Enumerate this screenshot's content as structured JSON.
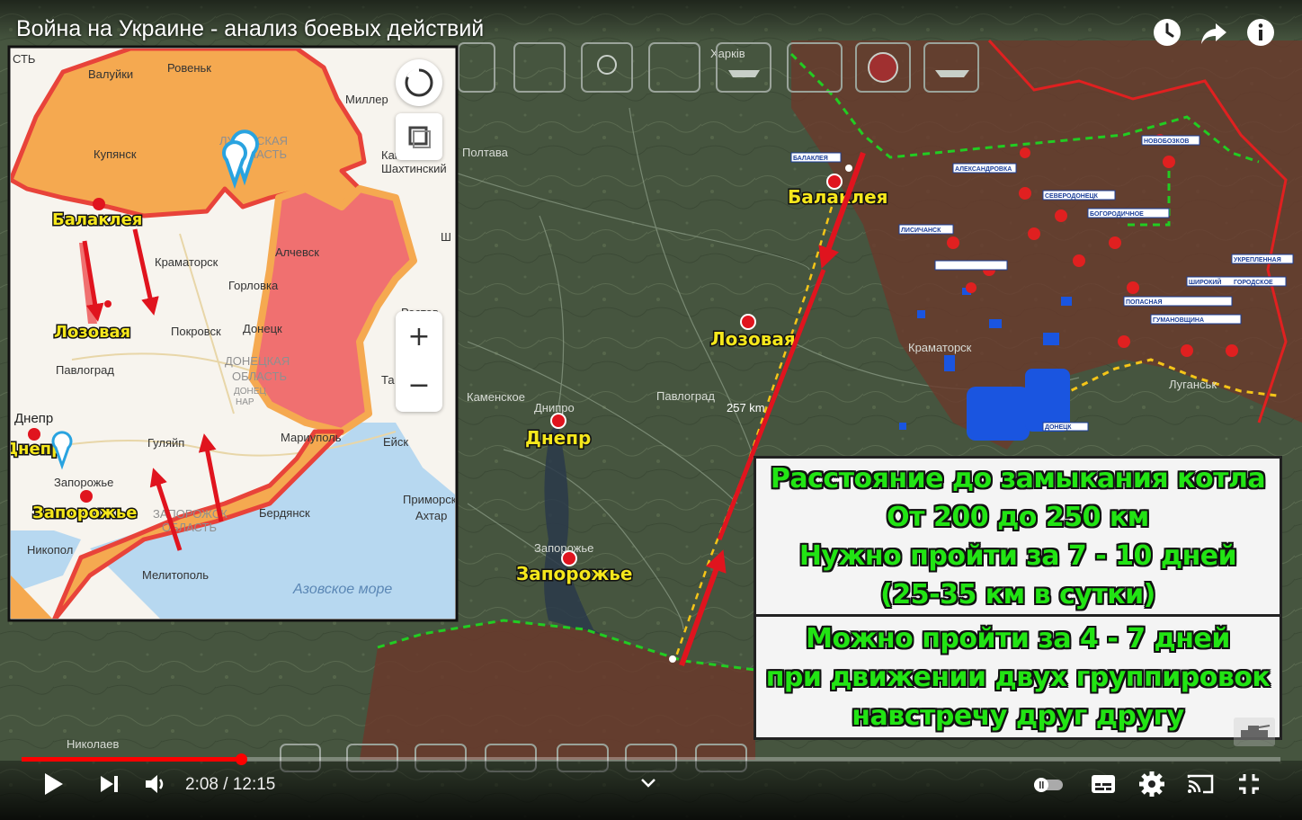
{
  "video": {
    "title": "Война на Украине - анализ боевых действий",
    "time_current": "2:08",
    "time_separator": " / ",
    "time_total": "12:15",
    "progress_fraction": 0.1742,
    "accent": "#ff0000"
  },
  "top_icons": [
    "watch-later-icon",
    "share-icon",
    "info-icon"
  ],
  "control_icons": [
    "play-icon",
    "next-icon",
    "volume-icon",
    "chevron-down-icon",
    "autoplay-toggle-icon",
    "subtitles-icon",
    "settings-icon",
    "cast-icon",
    "fullscreen-icon"
  ],
  "inset_map": {
    "regions": {
      "luhansk": [
        "ЛУГАНСКАЯ",
        "ОБЛАСТЬ"
      ],
      "donetsk": [
        "ДОНЕЦКАЯ",
        "ОБЛАСТЬ"
      ],
      "donetsk_small": [
        "ДОНЕЦ",
        "НАР"
      ],
      "zaporozhye": [
        "ЗАПОРОЖСК",
        "ОБЛАСТЬ"
      ],
      "sea": "Азовское море"
    },
    "towns": [
      "Валуйки",
      "Ровеньк",
      "Миллер",
      "Купянск",
      "Каменск-",
      "Шахтинский",
      "Краматорск",
      "Горловка",
      "Алчевск",
      "Донецк",
      "Покровск",
      "Павлоград",
      "Гуляйп",
      "Мариуполь",
      "Бердянск",
      "Ейск",
      "Никопол",
      "Мелитополь",
      "Запорожье",
      "Приморск",
      "Ахтар",
      "Ростов",
      "Та",
      "Ш",
      "СТЬ"
    ],
    "cities": [
      "Балаклея",
      "Лозовая",
      "Днепр",
      "Днепр",
      "Запорожье"
    ],
    "zoom_in": "+",
    "zoom_out": "−"
  },
  "main_map": {
    "cities": [
      "Балаклея",
      "Лозовая",
      "Днепр",
      "Запорожье"
    ],
    "towns": [
      "Полтава",
      "Днипро",
      "Павлоград",
      "Каменское",
      "Запорожье",
      "Николаев",
      "Краматорск",
      "Луганськ",
      "Харків",
      "257 km"
    ],
    "unit_labels": [
      "НОВОБОЗКОВ",
      "АЛЕКСАНДРОВКА",
      "БАЛАКЛЕЯ",
      "БОГОРОДИЧНОЕ",
      "СЕВЕРОДОНЕЦК",
      "ЛИСИЧАНСК",
      "УКРЕПЛЕННАЯ",
      "ШИРОКИЙ",
      "ГОРОДСКОЕ",
      "ГУМАНОВЩИНА",
      "ПОПАСНАЯ",
      "ДОНЕЦК"
    ]
  },
  "info_box": {
    "upper_lines": [
      "Расстояние до замыкания котла",
      "От 200 до 250 км",
      "Нужно пройти за 7 - 10 дней",
      "(25-35 км в сутки)"
    ],
    "lower_lines": [
      "Можно пройти за 4 - 7 дней",
      "при движении двух группировок",
      "навстречу друг другу"
    ],
    "text_color": "#22e414"
  },
  "colors": {
    "occupied_fill": "#f5a950",
    "dnr_fill": "#f07070",
    "front_line": "#e8433a",
    "arrow": "#e0141e",
    "green_dash": "#22cc22",
    "yellow_dash": "#f5c518"
  }
}
